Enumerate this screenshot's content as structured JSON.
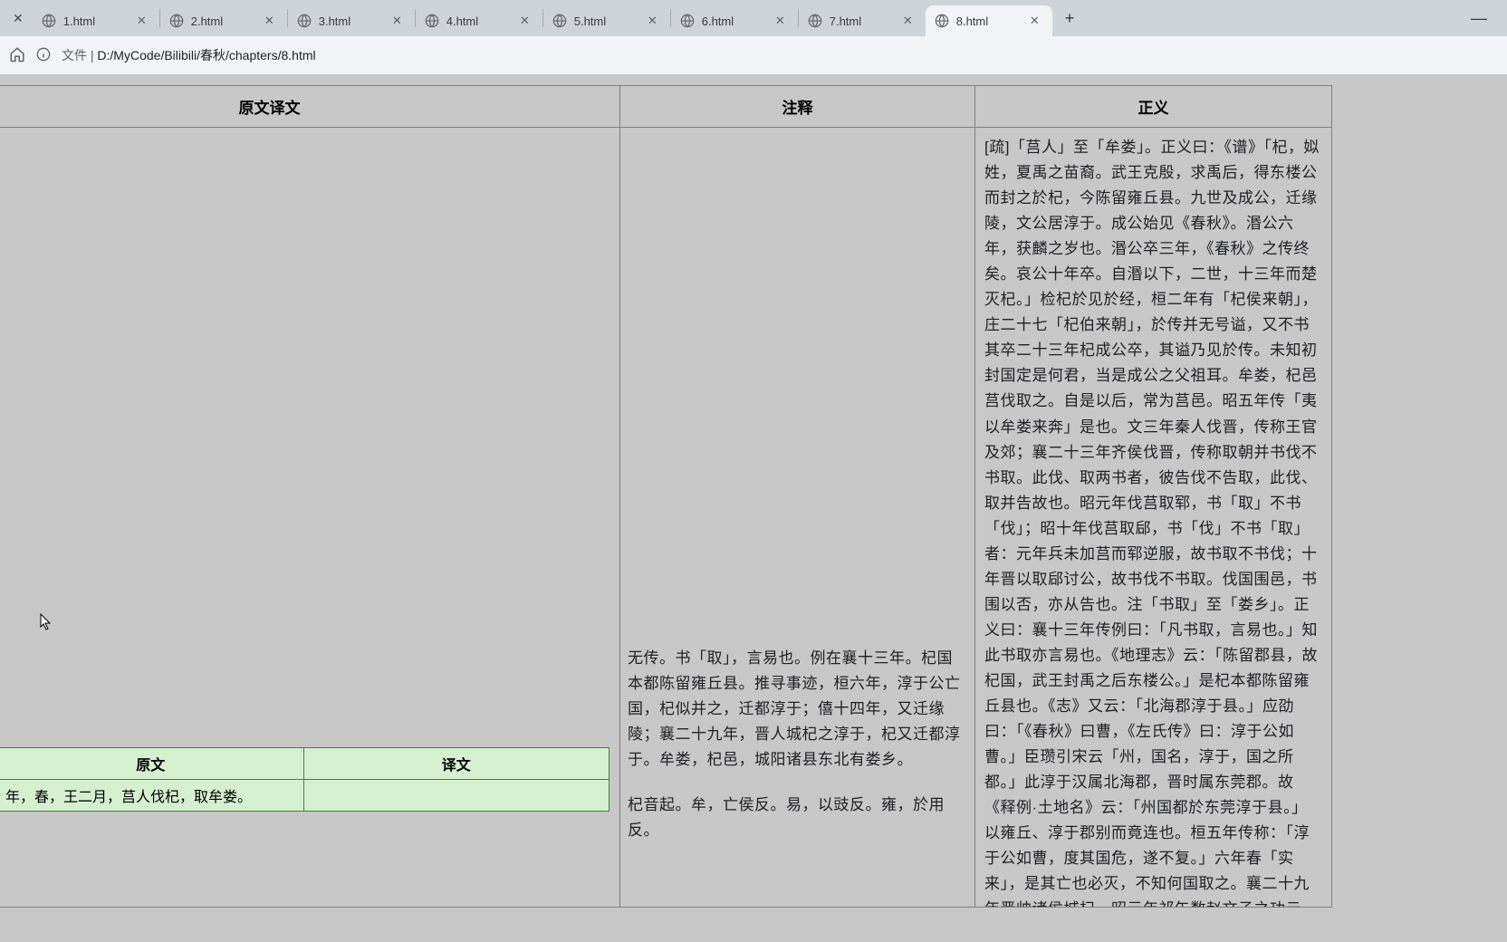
{
  "browser": {
    "tabs": [
      {
        "title": "1.html"
      },
      {
        "title": "2.html"
      },
      {
        "title": "3.html"
      },
      {
        "title": "4.html"
      },
      {
        "title": "5.html"
      },
      {
        "title": "6.html"
      },
      {
        "title": "7.html"
      },
      {
        "title": "8.html"
      }
    ],
    "active_tab_index": 7,
    "address_prefix": "文件",
    "address_path": "D:/MyCode/Bilibili/春秋/chapters/8.html"
  },
  "headers": {
    "col1": "原文译文",
    "col2": "注释",
    "col3": "正义"
  },
  "inner_table": {
    "header1": "原文",
    "header2": "译文",
    "row1_col1": "年，春，王二月，莒人伐杞，取牟娄。",
    "row1_col2": ""
  },
  "annotation": {
    "p1": "无传。书「取」，言易也。例在襄十三年。杞国本都陈留雍丘县。推寻事迹，桓六年，淳于公亡国，杞似并之，迁都淳于；僖十四年，又迁缘陵；襄二十九年，晋人城杞之淳于，杞又迁都淳于。牟娄，杞邑，城阳诸县东北有娄乡。",
    "p2": "杞音起。牟，亡侯反。易，以豉反。雍，於用反。"
  },
  "zhengyi": {
    "text": "[疏]「莒人」至「牟娄」。正义曰：《谱》「杞，姒姓，夏禹之苗裔。武王克殷，求禹后，得东楼公而封之於杞，今陈留雍丘县。九世及成公，迁缘陵，文公居淳于。成公始见《春秋》。湣公六年，获麟之岁也。湣公卒三年，《春秋》之传终矣。哀公十年卒。自湣以下，二世，十三年而楚灭杞。」检杞於见於经，桓二年有「杞侯来朝」，庄二十七「杞伯来朝」，於传并无号谥，又不书其卒二十三年杞成公卒，其谥乃见於传。未知初封国定是何君，当是成公之父祖耳。牟娄，杞邑莒伐取之。自是以后，常为莒邑。昭五年传「夷以牟娄来奔」是也。文三年秦人伐晋，传称王官及郊；襄二十三年齐侯伐晋，传称取朝并书伐不书取。此伐、取两书者，彼告伐不告取，此伐、取并告故也。昭元年伐莒取郓，书「取」不书「伐」；昭十年伐莒取郈，书「伐」不书「取」者：元年兵未加莒而郓逆服，故书取不书伐；十年晋以取郈讨公，故书伐不书取。伐国围邑，书围以否，亦从告也。注「书取」至「娄乡」。正义曰：襄十三年传例曰：「凡书取，言易也。」知此书取亦言易也。《地理志》云：「陈留郡县，故杞国，武王封禹之后东楼公。」是杞本都陈留雍丘县也。《志》又云：「北海郡淳于县。」应劭曰：「《春秋》曰曹，《左氏传》曰：淳于公如曹。」臣瓒引宋云「州，国名，淳于，国之所都。」此淳于汉属北海郡，晋时属东莞郡。故《释例·土地名》云：「州国都於东莞淳于县。」以雍丘、淳于郡别而竟连也。桓五年传称：「淳于公如曹，度其国危，遂不复。」六年春「实来」，是其亡也必灭，不知何国取之。襄二十九年晋帅诸侯城杞。昭元年祁午数赵文子之功云「城淳于」"
  },
  "icons": {
    "globe": "globe-icon"
  }
}
